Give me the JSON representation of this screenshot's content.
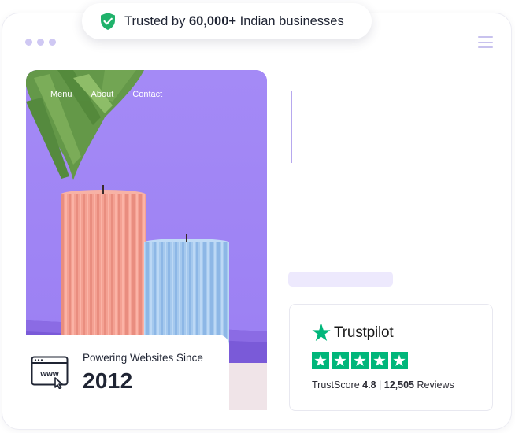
{
  "trust_banner": {
    "prefix": "Trusted by",
    "count": "60,000+",
    "suffix": "Indian businesses",
    "icon": "shield-check-icon",
    "icon_color": "#20b26b"
  },
  "window": {
    "dots": 3,
    "menu_icon": "hamburger-icon"
  },
  "hero": {
    "nav": [
      "Menu",
      "About",
      "Contact"
    ],
    "background_color": "#a385f7"
  },
  "powering": {
    "label": "Powering Websites Since",
    "year": "2012",
    "icon": "www-browser-icon"
  },
  "trustpilot": {
    "brand": "Trustpilot",
    "star_count": 5,
    "star_color": "#00b67a",
    "score_label": "TrustScore",
    "score": "4.8",
    "separator": "|",
    "reviews_count": "12,505",
    "reviews_label": "Reviews"
  },
  "colors": {
    "accent_lavender": "#ede9fd",
    "accent_purple_line": "#b6a8ee"
  }
}
